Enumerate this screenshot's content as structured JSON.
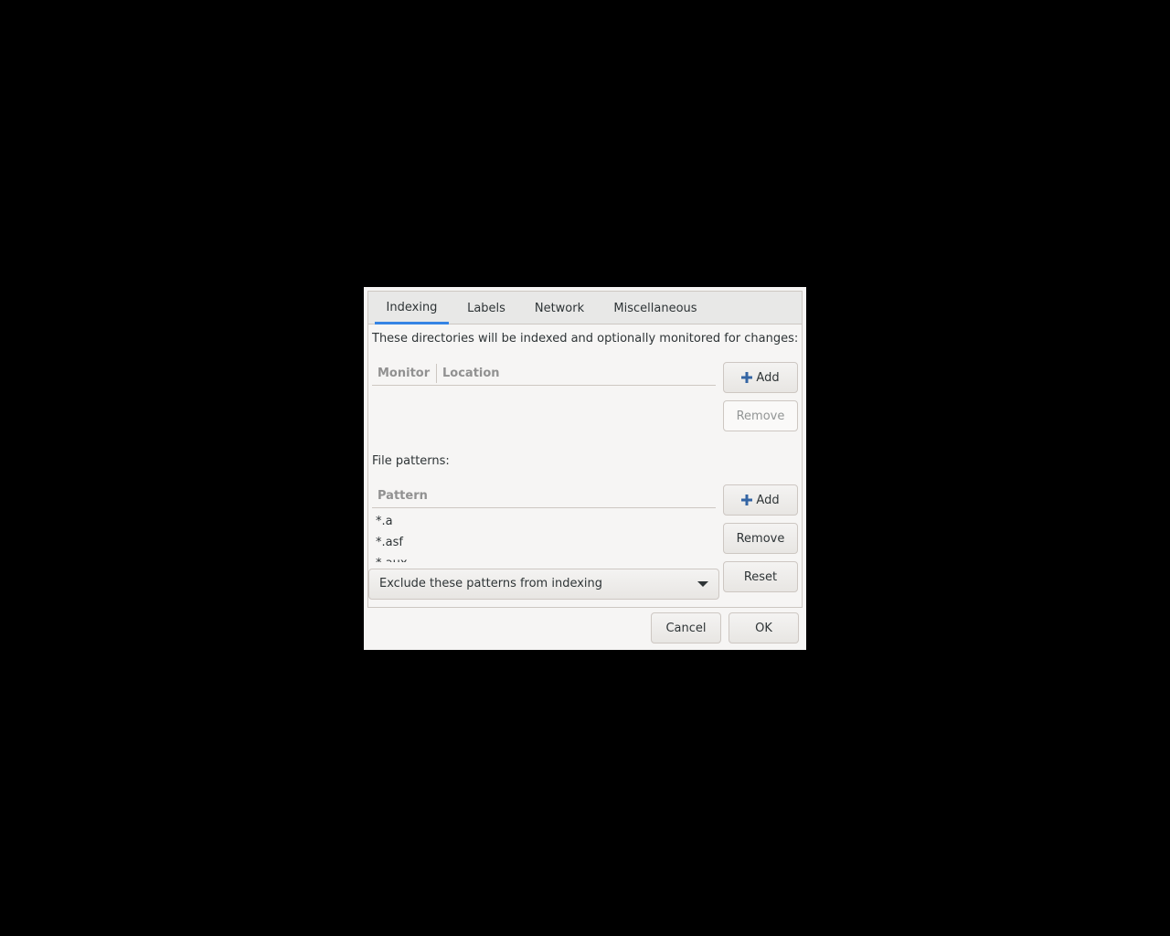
{
  "tabs": [
    {
      "label": "Indexing",
      "active": true
    },
    {
      "label": "Labels",
      "active": false
    },
    {
      "label": "Network",
      "active": false
    },
    {
      "label": "Miscellaneous",
      "active": false
    }
  ],
  "indexing": {
    "directories_caption": "These directories will be indexed and optionally monitored for changes:",
    "directories_table": {
      "columns": [
        "Monitor",
        "Location"
      ],
      "rows": []
    },
    "directories_add_label": "Add",
    "directories_remove_label": "Remove",
    "patterns_caption": "File patterns:",
    "patterns_table": {
      "columns": [
        "Pattern"
      ],
      "rows": [
        "*.a",
        "*.asf",
        "*.aux"
      ]
    },
    "patterns_add_label": "Add",
    "patterns_remove_label": "Remove",
    "patterns_reset_label": "Reset",
    "pattern_mode": "Exclude these patterns from indexing"
  },
  "dialog_buttons": {
    "cancel_label": "Cancel",
    "ok_label": "OK"
  },
  "colors": {
    "accent": "#3584e4",
    "plus_icon": "#3465a4",
    "window_bg": "#f6f5f4",
    "screen_bg": "#000000"
  }
}
